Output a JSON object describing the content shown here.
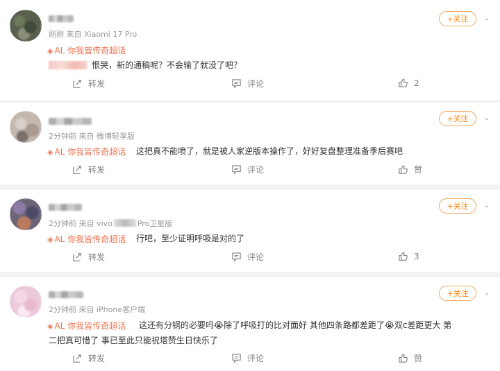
{
  "comments": [
    {
      "meta": "刚刚 来自 Xiaomi 17 Pro",
      "topic": "AL 你我皆传奇超话",
      "text": "恨哭，新的通稿呢？不会输了就没了吧？",
      "text_line2": "",
      "follow_label": "+关注",
      "actions": {
        "forward": "转发",
        "comment": "评论",
        "like": "2"
      }
    },
    {
      "meta": "2分钟前 来自 微博轻享版",
      "topic": "AL 你我皆传奇超话",
      "text": "这把真不能喷了，就是被人家逆版本操作了，好好复盘整理准备季后赛吧",
      "text_line2": "",
      "follow_label": "+关注",
      "actions": {
        "forward": "转发",
        "comment": "评论",
        "like": "赞"
      }
    },
    {
      "meta_prefix": "2分钟前 来自 vivo",
      "meta_suffix": "Pro卫星版",
      "topic": "AL 你我皆传奇超话",
      "text": "行吧，至少证明呼吸是对的了",
      "text_line2": "",
      "follow_label": "+关注",
      "actions": {
        "forward": "转发",
        "comment": "评论",
        "like": "3"
      }
    },
    {
      "meta": "2分钟前 来自 iPhone客户端",
      "topic": "AL 你我皆传奇超话",
      "text": "这还有分锅的必要吗😭除了呼吸打的比对面好 其他四条路都差距了😭双c差距更大 第",
      "text_line2": "二把真可惜了 事已至此只能祝塔赞生日快乐了",
      "follow_label": "+关注",
      "actions": {
        "forward": "转发",
        "comment": "评论",
        "like": "赞"
      }
    }
  ],
  "colors": {
    "accent": "#ff8200",
    "topic": "#eb7350",
    "meta": "#999999"
  }
}
